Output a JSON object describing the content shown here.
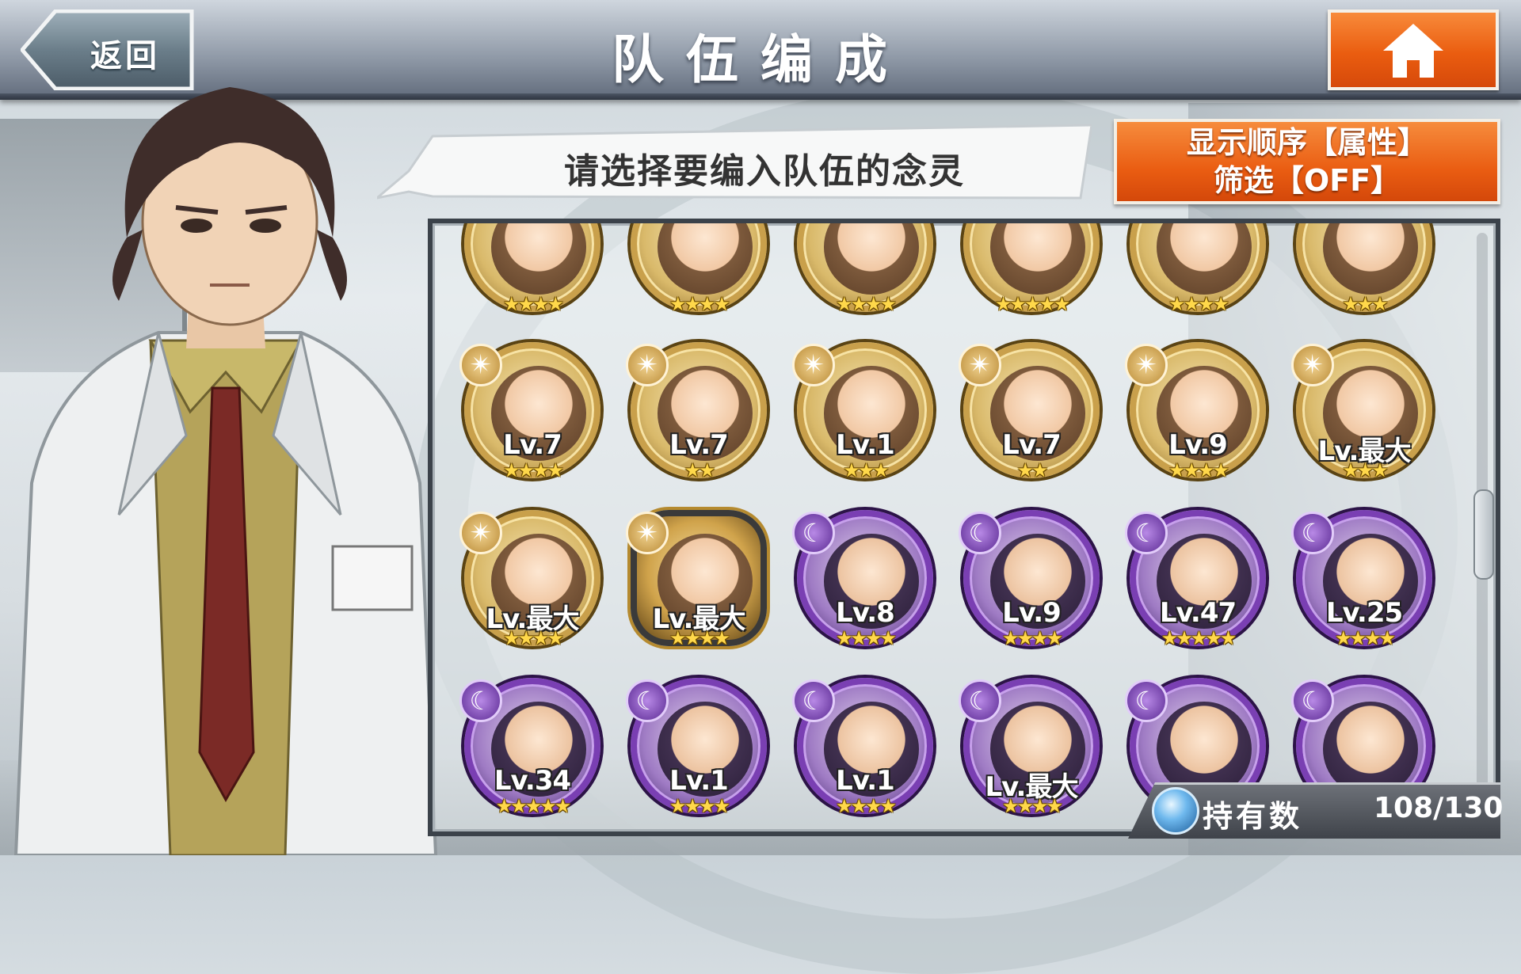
{
  "header": {
    "back_label": "返回",
    "title": "队伍编成"
  },
  "bubble": {
    "text": "请选择要编入队伍的念灵"
  },
  "sort": {
    "line1": "显示顺序【属性】",
    "line2": "筛选【OFF】"
  },
  "units": [
    {
      "type": "gold",
      "badge": "",
      "level": "",
      "stars": "★★★★"
    },
    {
      "type": "gold",
      "badge": "",
      "level": "",
      "stars": "★★★★"
    },
    {
      "type": "gold",
      "badge": "",
      "level": "",
      "stars": "★★★★"
    },
    {
      "type": "gold",
      "badge": "",
      "level": "",
      "stars": "★★★★★"
    },
    {
      "type": "gold",
      "badge": "",
      "level": "",
      "stars": "★★★★"
    },
    {
      "type": "gold",
      "badge": "",
      "level": "",
      "stars": "★★★"
    },
    {
      "type": "gold",
      "badge": "sun",
      "level": "Lv.7",
      "stars": "★★★★"
    },
    {
      "type": "gold",
      "badge": "sun",
      "level": "Lv.7",
      "stars": "★★"
    },
    {
      "type": "gold",
      "badge": "sun",
      "level": "Lv.1",
      "stars": "★★★"
    },
    {
      "type": "gold",
      "badge": "sun",
      "level": "Lv.7",
      "stars": "★★"
    },
    {
      "type": "gold",
      "badge": "sun",
      "level": "Lv.9",
      "stars": "★★★★"
    },
    {
      "type": "gold",
      "badge": "sun",
      "level": "Lv.最大",
      "stars": "★★★"
    },
    {
      "type": "gold",
      "badge": "sun",
      "level": "Lv.最大",
      "stars": "★★★★"
    },
    {
      "type": "oct",
      "badge": "sun",
      "level": "Lv.最大",
      "stars": "★★★★"
    },
    {
      "type": "purple",
      "badge": "moon",
      "level": "Lv.8",
      "stars": "★★★★"
    },
    {
      "type": "purple",
      "badge": "moon",
      "level": "Lv.9",
      "stars": "★★★★"
    },
    {
      "type": "purple",
      "badge": "moon",
      "level": "Lv.47",
      "stars": "★★★★★"
    },
    {
      "type": "purple",
      "badge": "moon",
      "level": "Lv.25",
      "stars": "★★★★"
    },
    {
      "type": "purple",
      "badge": "moon",
      "level": "Lv.34",
      "stars": "★★★★★"
    },
    {
      "type": "purple",
      "badge": "moon",
      "level": "Lv.1",
      "stars": "★★★★"
    },
    {
      "type": "purple",
      "badge": "moon",
      "level": "Lv.1",
      "stars": "★★★★"
    },
    {
      "type": "purple",
      "badge": "moon",
      "level": "Lv.最大",
      "stars": "★★★★"
    },
    {
      "type": "purple",
      "badge": "moon",
      "level": "",
      "stars": ""
    },
    {
      "type": "purple",
      "badge": "moon",
      "level": "",
      "stars": ""
    }
  ],
  "owned": {
    "label": "持有数",
    "count": "108/130"
  },
  "colors": {
    "accent_orange": "#ea5d10",
    "gold_frame": "#c9a04b",
    "purple_frame": "#7a3fb3",
    "star": "#ffd84a"
  }
}
